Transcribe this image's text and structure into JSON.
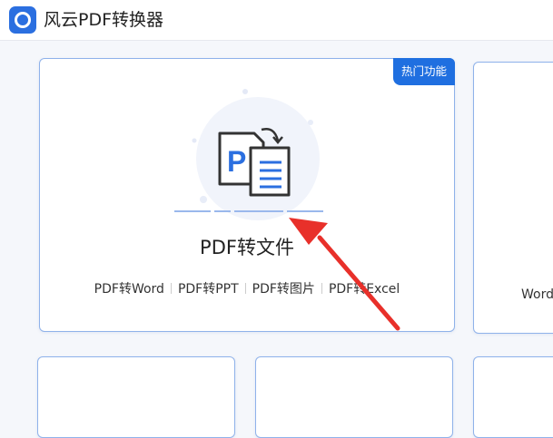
{
  "app": {
    "title": "风云PDF转换器",
    "logo_icon": "app-logo-icon",
    "accent": "#2b6fe0"
  },
  "featured_card": {
    "badge": "热门功能",
    "title": "PDF转文件",
    "sub_items": [
      {
        "label": "PDF转Word"
      },
      {
        "label": "PDF转PPT"
      },
      {
        "label": "PDF转图片"
      },
      {
        "label": "PDF转Excel"
      }
    ],
    "icon": "pdf-convert-icon",
    "icon_letter": "P"
  },
  "side_card": {
    "partial_label": "Word"
  },
  "annotation": {
    "icon": "red-arrow-icon",
    "color": "#e8302a"
  }
}
